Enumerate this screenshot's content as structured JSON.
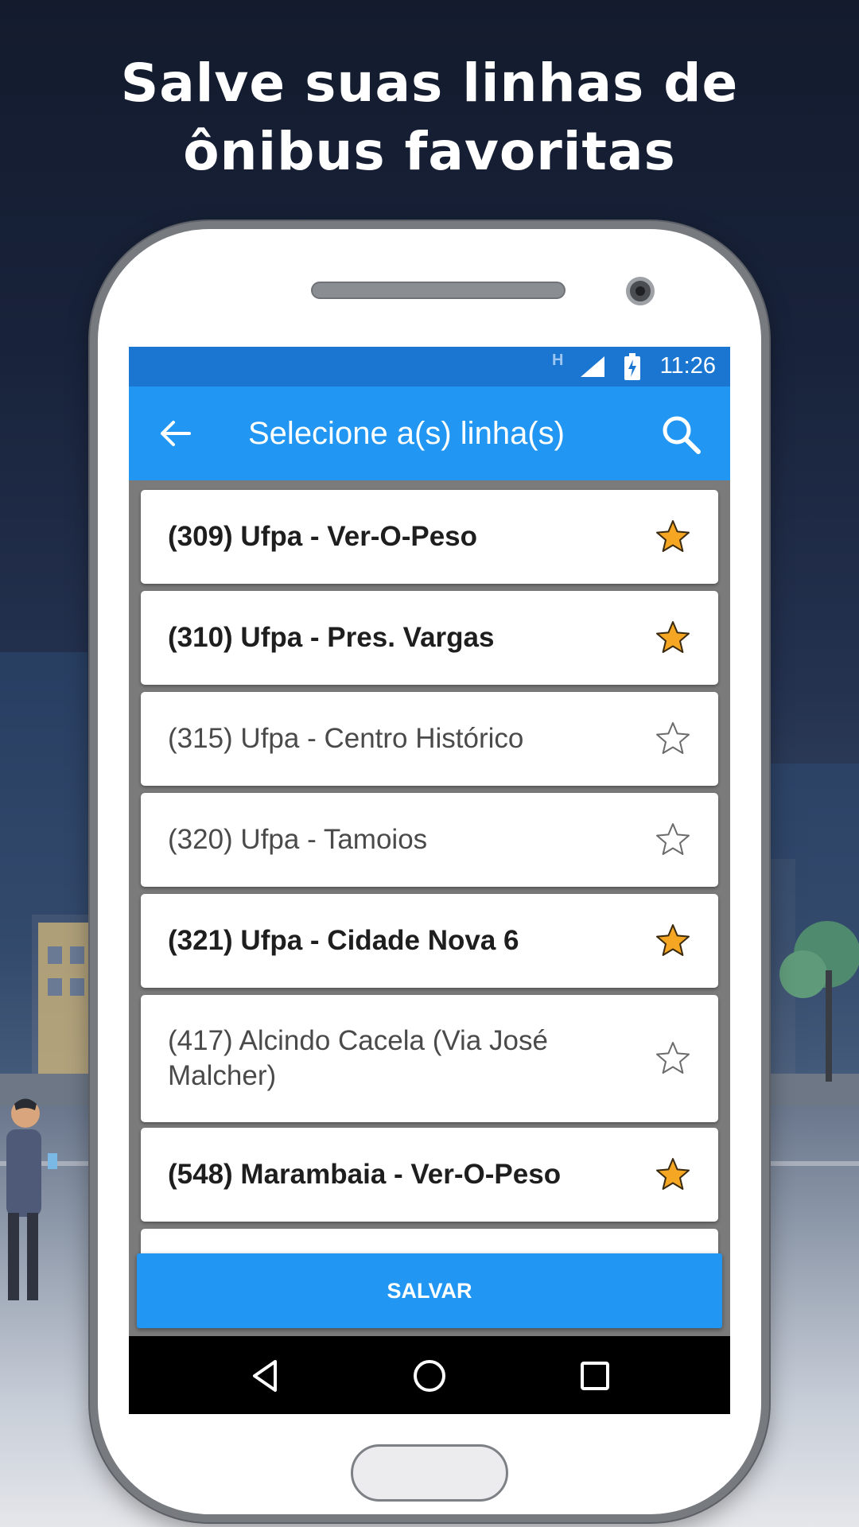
{
  "headline": {
    "line1": "Salve suas linhas de",
    "line2": "ônibus favoritas"
  },
  "status_bar": {
    "network": "H",
    "time": "11:26"
  },
  "toolbar": {
    "title": "Selecione a(s) linha(s)",
    "back_icon": "arrow-left-icon",
    "search_icon": "search-icon"
  },
  "bus_lines": [
    {
      "label": "(309) Ufpa - Ver-O-Peso",
      "favorite": true
    },
    {
      "label": "(310) Ufpa - Pres. Vargas",
      "favorite": true
    },
    {
      "label": "(315) Ufpa - Centro Histórico",
      "favorite": false
    },
    {
      "label": "(320) Ufpa - Tamoios",
      "favorite": false
    },
    {
      "label": "(321) Ufpa - Cidade Nova 6",
      "favorite": true
    },
    {
      "label": "(417) Alcindo Cacela (Via José Malcher)",
      "favorite": false
    },
    {
      "label": "(548) Marambaia - Ver-O-Peso",
      "favorite": true
    }
  ],
  "save_button": {
    "label": "SALVAR"
  },
  "colors": {
    "primary": "#2196f3",
    "primary_dark": "#1b76d2",
    "star_filled": "#f5a623",
    "star_outline": "#6b6b6b"
  }
}
